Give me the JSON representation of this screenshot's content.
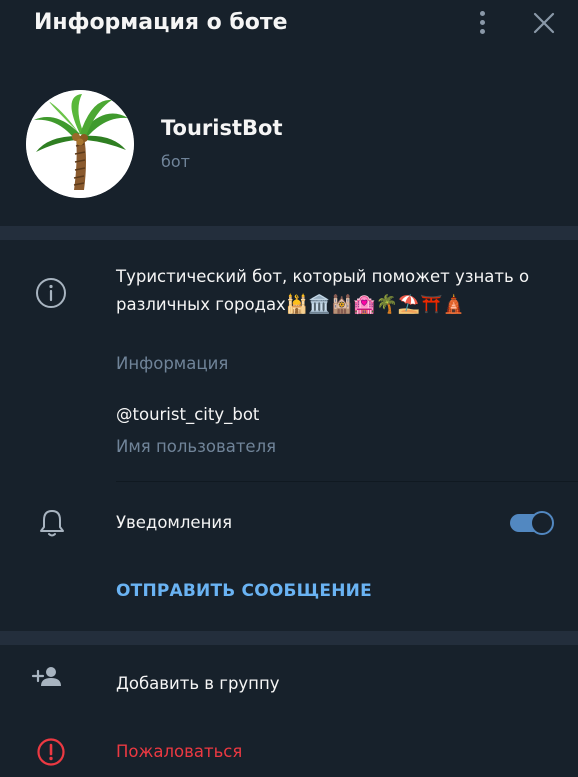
{
  "header": {
    "title": "Информация о боте",
    "menu_icon": "kebab-menu-icon",
    "close_icon": "close-icon"
  },
  "profile": {
    "avatar_icon": "palm-tree-avatar",
    "name": "TouristBot",
    "type": "бот"
  },
  "info": {
    "icon": "info-icon",
    "description_text": "Туристический бот, который поможет узнать о различных городах",
    "description_emojis": "🕌🏛️🕍🏩🌴⛱️⛩️🛕",
    "description_label": "Информация",
    "username": "@tourist_city_bot",
    "username_label": "Имя пользователя"
  },
  "notifications": {
    "icon": "bell-icon",
    "label": "Уведомления",
    "enabled": true
  },
  "send_message": {
    "label": "ОТПРАВИТЬ СООБЩЕНИЕ"
  },
  "actions": {
    "add_to_group": {
      "icon": "add-user-icon",
      "label": "Добавить в группу"
    },
    "report": {
      "icon": "report-icon",
      "label": "Пожаловаться"
    }
  },
  "colors": {
    "background": "#17212b",
    "separator": "#232e3c",
    "muted_text": "#708499",
    "accent": "#6ab3f3",
    "toggle": "#5288c1",
    "danger": "#ec3942"
  }
}
